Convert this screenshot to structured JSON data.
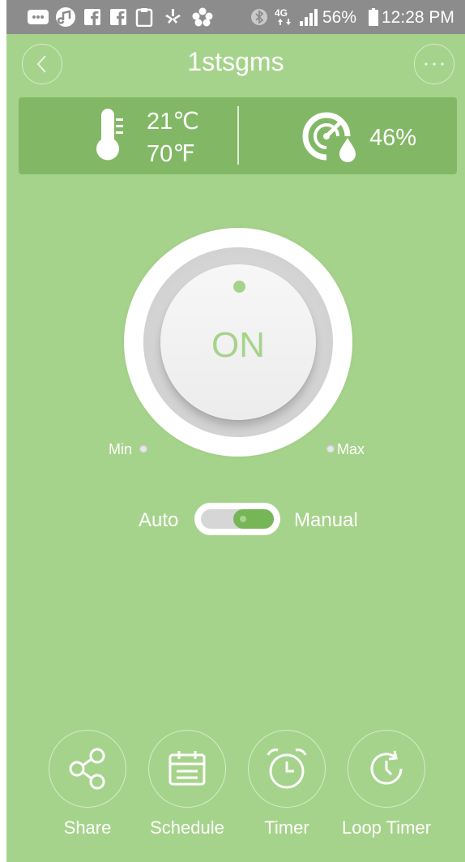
{
  "status_bar": {
    "battery": "56%",
    "time": "12:28 PM",
    "network": "4G",
    "icons": [
      "message-icon",
      "music-app-icon",
      "facebook-icon",
      "facebook-icon",
      "clipboard-icon",
      "yelp-icon",
      "flower-icon",
      "bluetooth-icon",
      "lte-icon",
      "signal-icon",
      "battery-icon"
    ]
  },
  "header": {
    "title": "1stsgms",
    "back_icon": "chevron-left-icon",
    "more_icon": "more-dots-icon"
  },
  "sensors": {
    "temp_c": "21℃",
    "temp_f": "70℉",
    "humidity": "46%"
  },
  "knob": {
    "state": "ON",
    "min_label": "Min",
    "max_label": "Max"
  },
  "mode": {
    "left_label": "Auto",
    "right_label": "Manual",
    "selected": "Manual"
  },
  "actions": [
    {
      "label": "Share",
      "icon": "share-icon"
    },
    {
      "label": "Schedule",
      "icon": "calendar-icon"
    },
    {
      "label": "Timer",
      "icon": "alarm-clock-icon"
    },
    {
      "label": "Loop Timer",
      "icon": "loop-timer-icon"
    }
  ],
  "colors": {
    "background": "#a6d38b",
    "panel": "#82b865",
    "accent": "#76b657",
    "status_bar": "#8c8c8c"
  }
}
